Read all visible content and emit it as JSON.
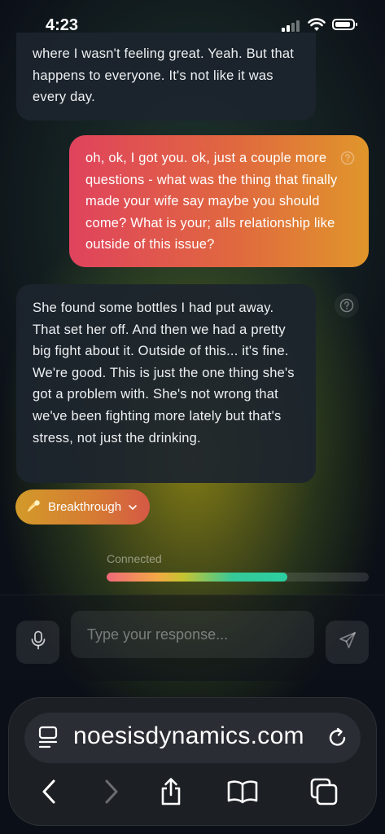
{
  "status_bar": {
    "time": "4:23"
  },
  "messages": [
    {
      "role": "assistant",
      "text": "where I wasn't feeling great. Yeah. But that happens to everyone. It's not like it was every day."
    },
    {
      "role": "user",
      "text": "oh, ok, I got you. ok, just a couple more questions - what was the thing that finally made your wife say maybe you should come? What is your; alls relationship like outside of this issue?"
    },
    {
      "role": "assistant",
      "text": "She found some bottles I had put away. That set her off. And then we had a pretty big fight about it. Outside of this... it's fine. We're good. This is just the one thing she's got a problem with. She's not wrong that we've been fighting more lately but that's stress, not just the drinking."
    }
  ],
  "breakthrough": {
    "label": "Breakthrough",
    "icon": "comet-icon"
  },
  "connection": {
    "label": "Connected",
    "progress": 0.69
  },
  "composer": {
    "placeholder": "Type your response...",
    "mic_icon": "mic-icon",
    "send_icon": "send-icon"
  },
  "browser": {
    "url": "noesisdynamics.com"
  },
  "colors": {
    "user_bubble_start": "#e0435d",
    "user_bubble_end": "#e0962b",
    "assistant_bubble": "#1c242e",
    "breakthrough_pill": "#d57a33"
  }
}
